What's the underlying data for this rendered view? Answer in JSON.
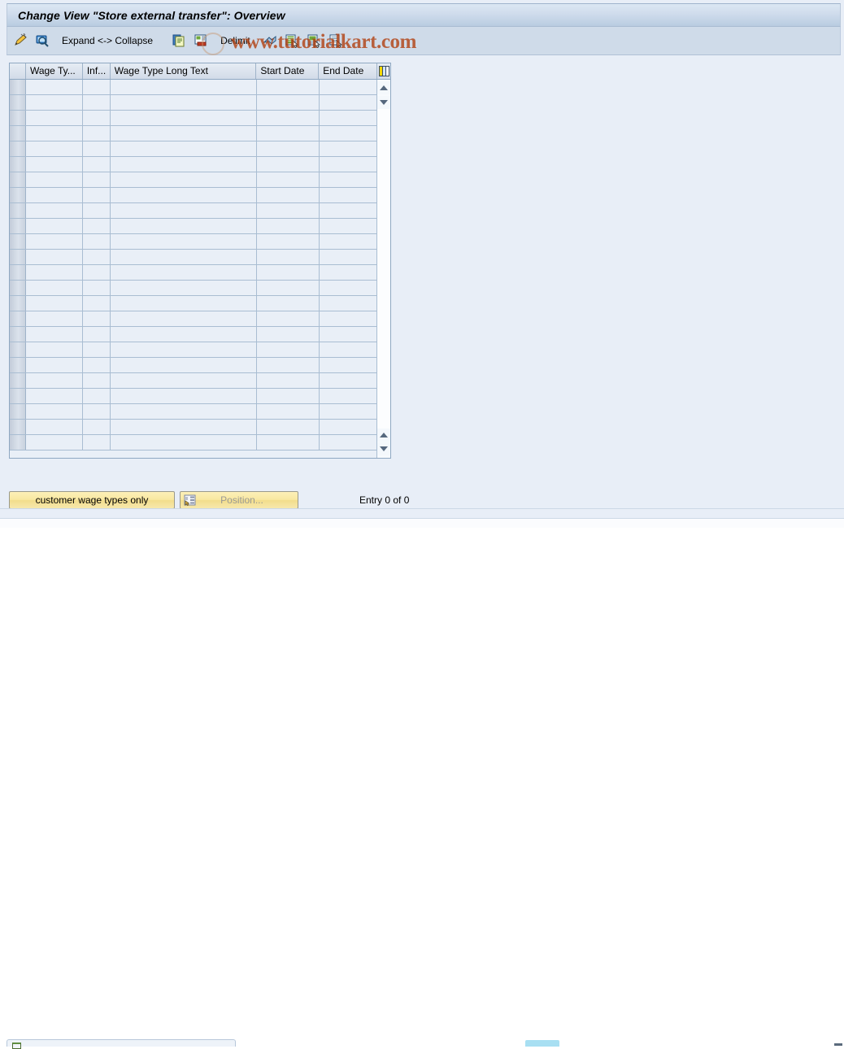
{
  "window": {
    "title": "Change View \"Store external transfer\": Overview"
  },
  "watermark": {
    "text": "www.tutorialkart.com",
    "color": "#b03c0c"
  },
  "toolbar": {
    "items": [
      {
        "name": "new-entries-icon",
        "label": "",
        "icon": "pencil-new-entries-icon",
        "type": "icon"
      },
      {
        "name": "display-details-icon",
        "label": "",
        "icon": "magnifier-display-icon",
        "type": "icon"
      },
      {
        "name": "expand-collapse-button",
        "label": "Expand <-> Collapse",
        "icon": "",
        "type": "text"
      },
      {
        "name": "copy-as-icon",
        "label": "",
        "icon": "copy-icon",
        "type": "icon"
      },
      {
        "name": "delete-icon",
        "label": "",
        "icon": "delete-row-icon",
        "type": "icon"
      },
      {
        "name": "delimit-button",
        "label": "Delimit",
        "icon": "",
        "type": "text"
      },
      {
        "name": "undo-icon",
        "label": "",
        "icon": "undo-arrow-icon",
        "type": "icon"
      },
      {
        "name": "select-all-icon",
        "label": "",
        "icon": "select-all-icon",
        "type": "icon"
      },
      {
        "name": "select-block-icon",
        "label": "",
        "icon": "select-block-icon",
        "type": "icon"
      },
      {
        "name": "deselect-all-icon",
        "label": "",
        "icon": "deselect-all-icon",
        "type": "icon"
      }
    ]
  },
  "table": {
    "name": "store-external-transfer-table",
    "columns": [
      {
        "key": "sel",
        "label": ""
      },
      {
        "key": "wagety",
        "label": "Wage Ty..."
      },
      {
        "key": "inf",
        "label": "Inf..."
      },
      {
        "key": "longtext",
        "label": "Wage Type Long Text"
      },
      {
        "key": "start",
        "label": "Start Date"
      },
      {
        "key": "end",
        "label": "End Date"
      }
    ],
    "header_config_icon": "table-settings-icon",
    "row_count": 24,
    "rows": []
  },
  "footer": {
    "customer_button_label": "customer wage types only",
    "position_button_label": "Position...",
    "position_icon": "position-icon",
    "entry_status": "Entry 0 of 0"
  },
  "scrollbar": {
    "name": "table-vertical-scrollbar",
    "up_arrow": "scroll-up-arrow-icon",
    "down_arrow": "scroll-down-arrow-icon"
  }
}
